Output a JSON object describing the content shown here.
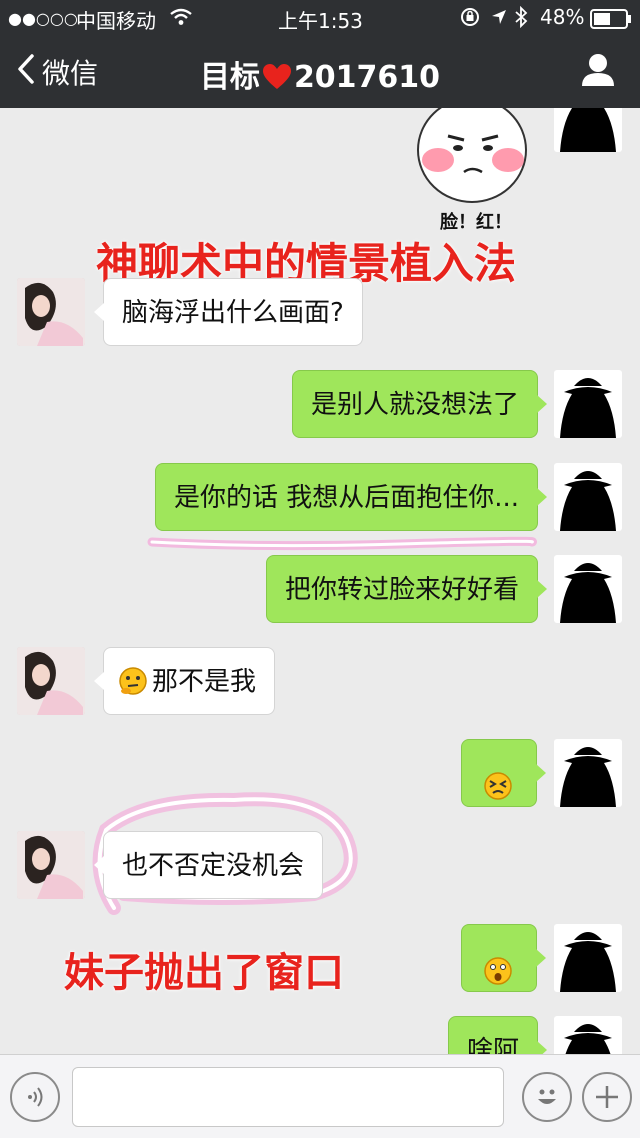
{
  "status_bar": {
    "signal": "●●○○○",
    "carrier": "中国移动",
    "time": "上午1:53",
    "battery": "48%"
  },
  "nav": {
    "back_label": "微信",
    "title_prefix": "目标",
    "title_suffix": "2017610"
  },
  "sticker": {
    "caption": "脸！红！"
  },
  "overlays": {
    "headline": "神聊术中的情景植入法",
    "window_note": "妹子抛出了窗口"
  },
  "messages": [
    {
      "side": "left",
      "text": "脑海浮出什么画面?"
    },
    {
      "side": "right",
      "text": "是别人就没想法了"
    },
    {
      "side": "right",
      "text": "是你的话 我想从后面抱住你..."
    },
    {
      "side": "right",
      "text": "把你转过脸来好好看"
    },
    {
      "side": "left",
      "text": "那不是我",
      "emoji": "thinking-emoji"
    },
    {
      "side": "right",
      "text": "",
      "emoji": "dizzy-face-emoji"
    },
    {
      "side": "left",
      "text": "也不否定没机会"
    },
    {
      "side": "right",
      "text": "",
      "emoji": "astonished-emoji"
    },
    {
      "side": "right",
      "text": "啥阿"
    }
  ],
  "input": {
    "placeholder": ""
  },
  "icons": {
    "voice": "voice-icon",
    "emoji": "smiley-icon",
    "plus": "plus-icon",
    "contact": "person-icon",
    "back": "chevron-left-icon"
  },
  "colors": {
    "nav_bg": "#2e3033",
    "chat_bg": "#ebebeb",
    "bubble_right": "#9fe65b",
    "bubble_left": "#ffffff",
    "overlay_red": "#e8231d",
    "highlight_pink": "#ff5fc8"
  }
}
